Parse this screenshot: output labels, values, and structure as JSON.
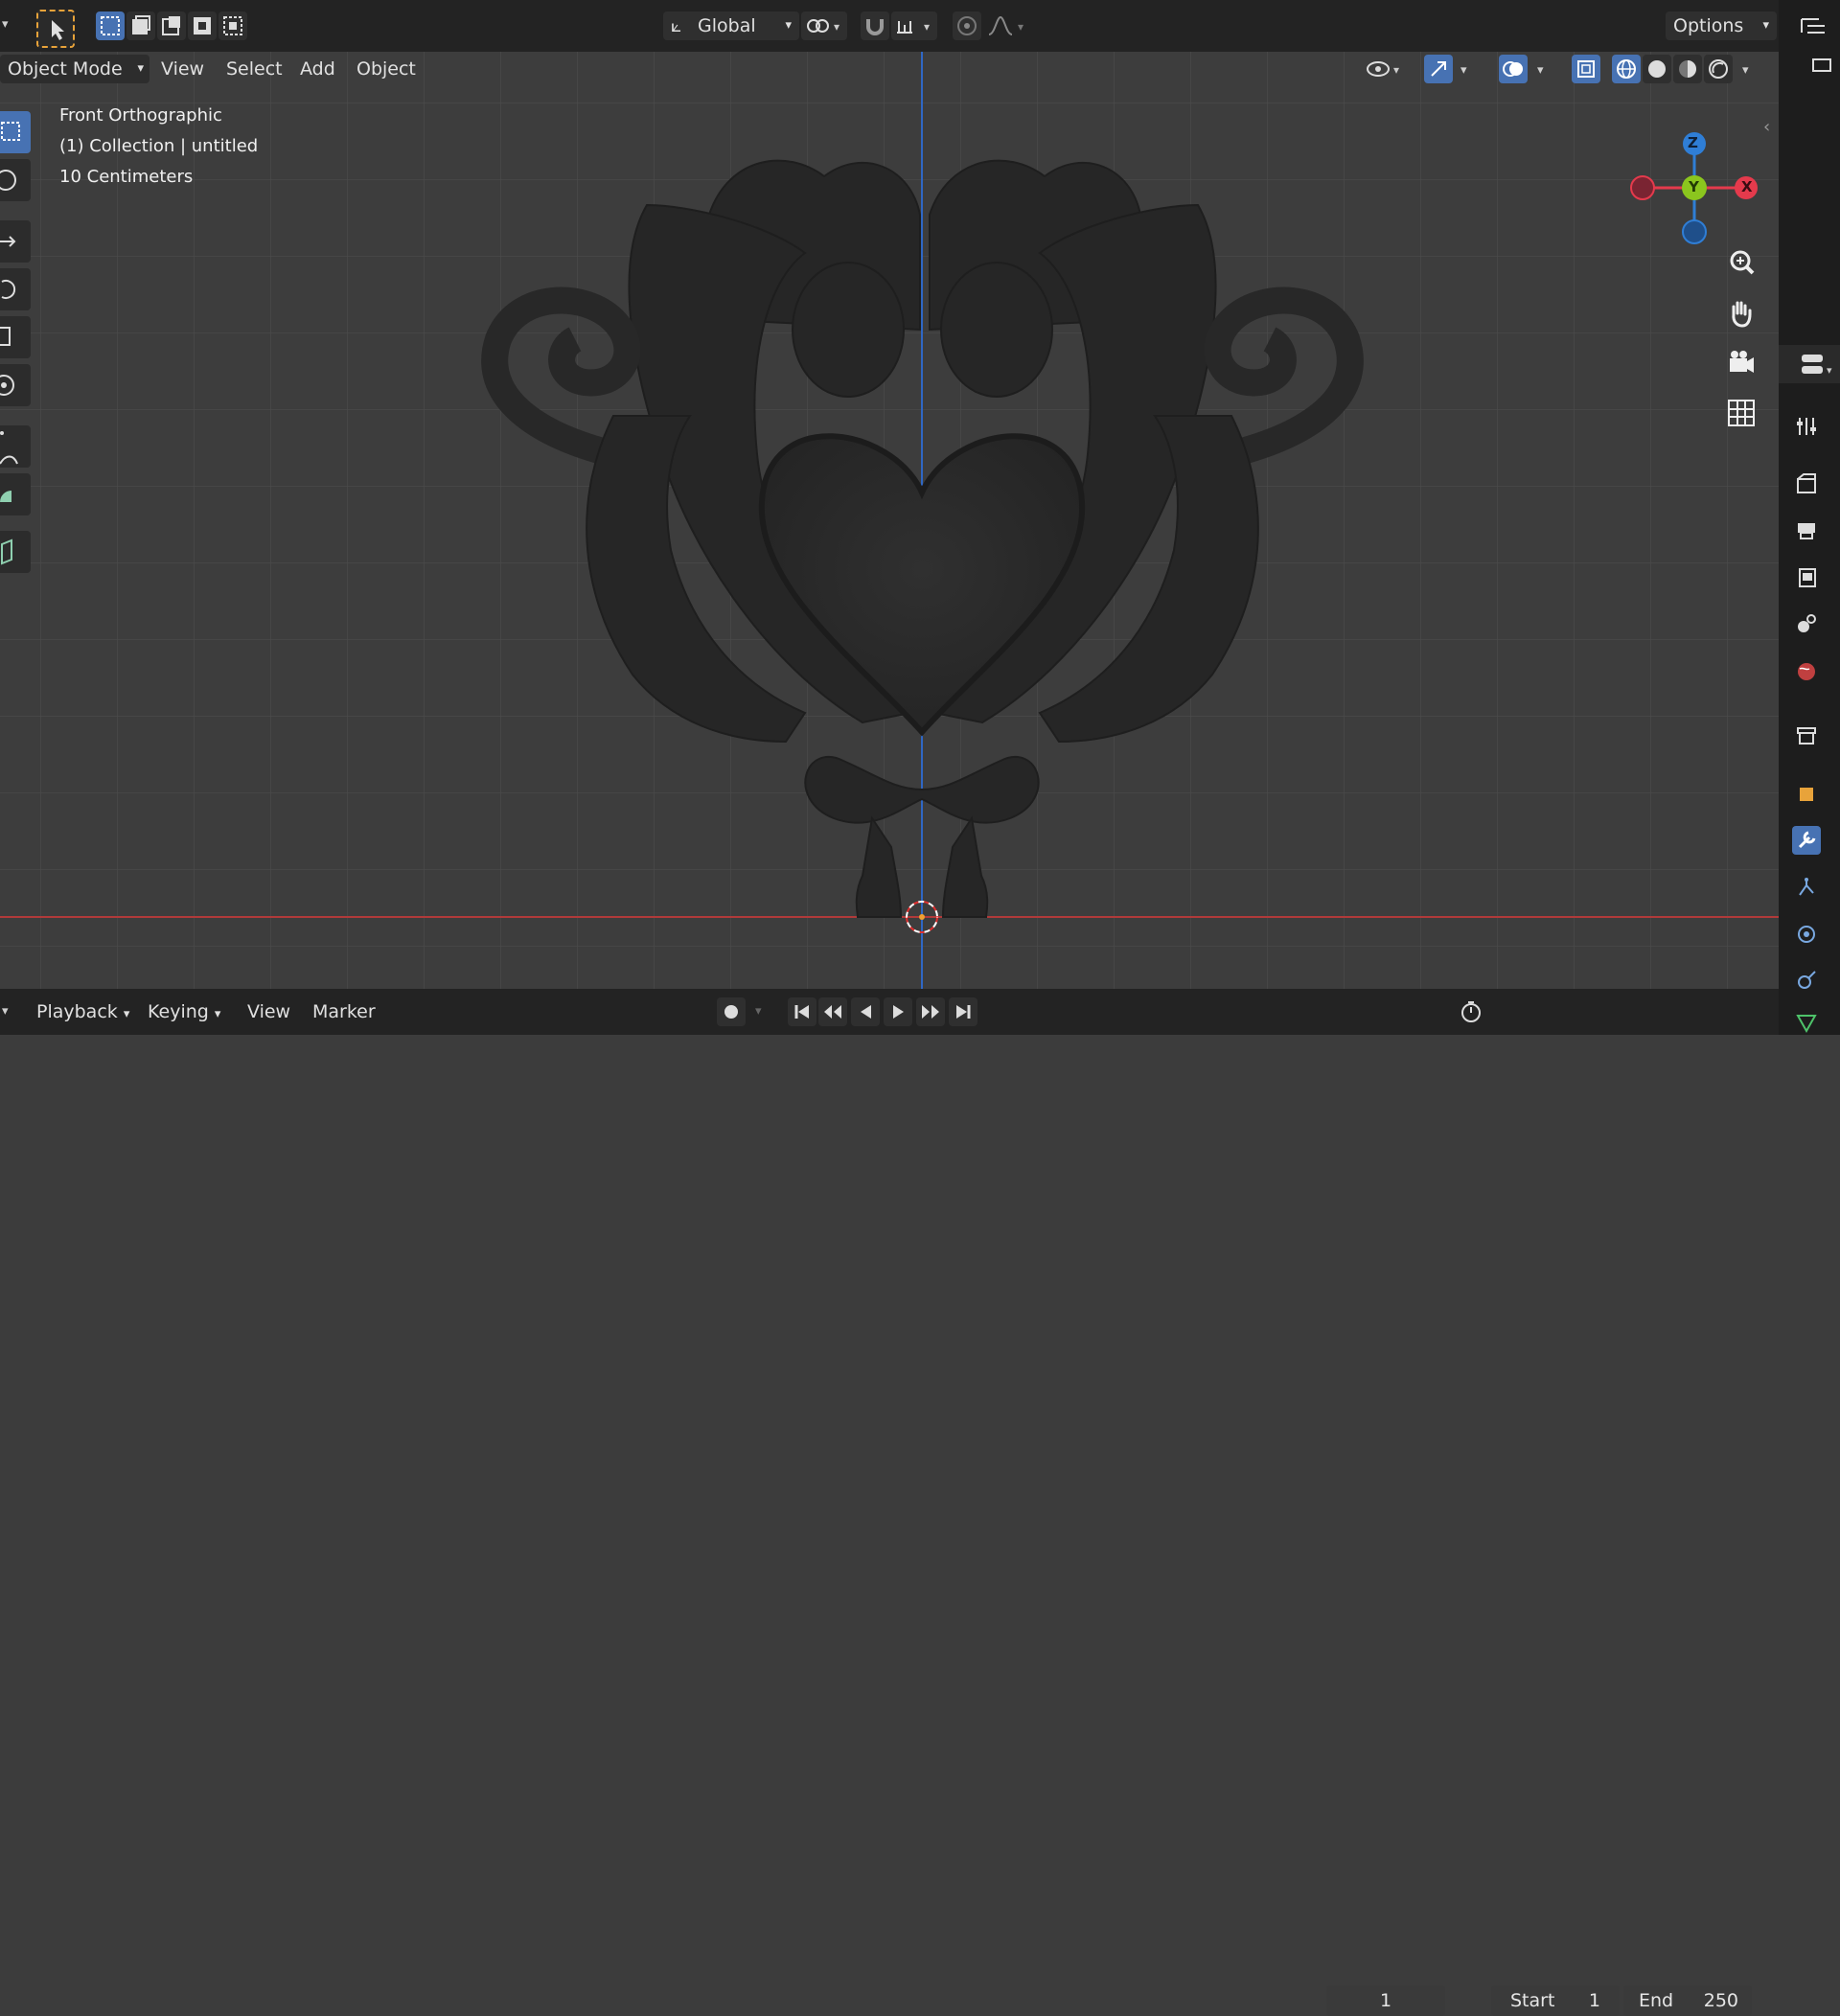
{
  "header": {
    "transform_orientation": "Global",
    "options_label": "Options"
  },
  "viewport_header": {
    "mode": "Object Mode",
    "menus": [
      "View",
      "Select",
      "Add",
      "Object"
    ]
  },
  "overlay": {
    "view_name": "Front Orthographic",
    "collection": "(1) Collection | untitled",
    "scale": "10 Centimeters"
  },
  "gizmo": {
    "z_label": "Z",
    "y_label": "Y",
    "x_label": "X",
    "colors": {
      "x": "#e53a4c",
      "y": "#8bc61e",
      "z": "#2f7ed6"
    }
  },
  "timeline": {
    "menus": [
      "Playback",
      "Keying",
      "View",
      "Marker"
    ],
    "current_frame": "1",
    "start_label": "Start",
    "start_value": "1",
    "end_label": "End",
    "end_value": "250"
  },
  "icons": {
    "select_tool": "cursor-select-icon",
    "nav_zoom": "zoom-icon",
    "nav_pan": "hand-icon",
    "nav_camera": "camera-icon",
    "nav_grid": "grid-icon"
  },
  "colors": {
    "accent": "#4772b3",
    "x_axis_line": "#b13a3a",
    "z_axis_line": "#2f67c4",
    "viewport_bg": "#3d3d3d"
  }
}
